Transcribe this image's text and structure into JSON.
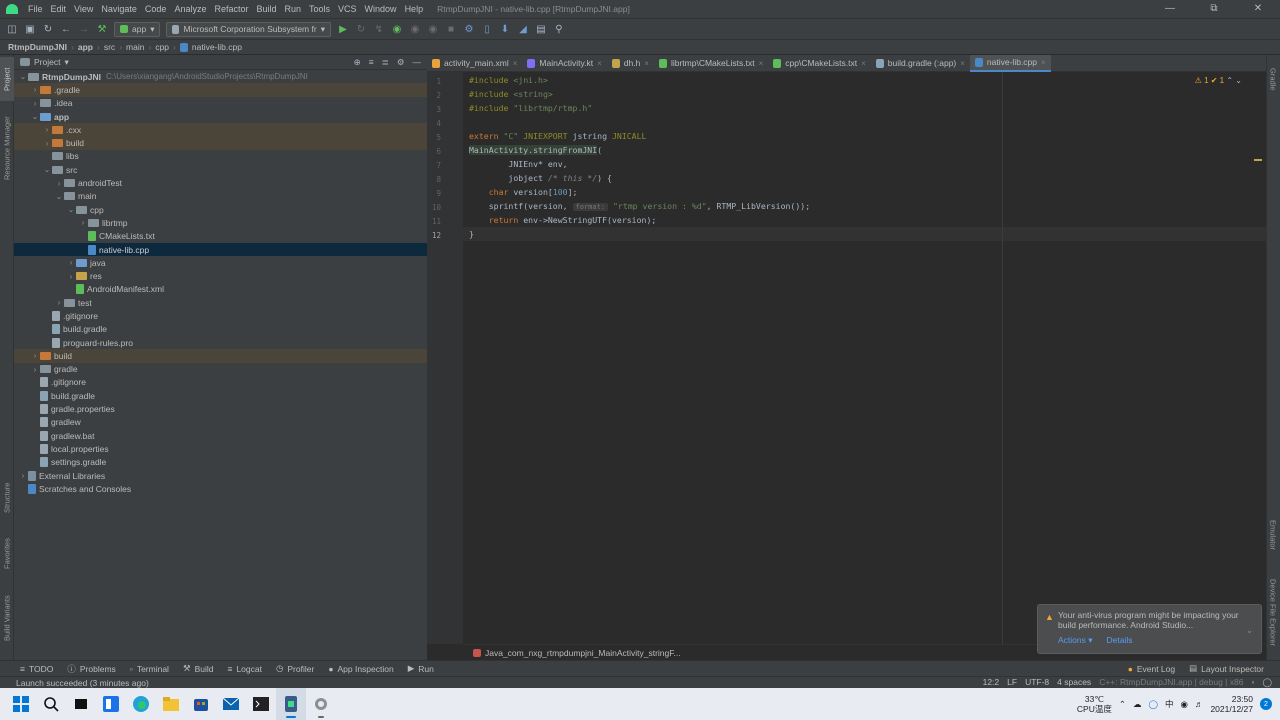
{
  "menu": {
    "items": [
      "File",
      "Edit",
      "View",
      "Navigate",
      "Code",
      "Analyze",
      "Refactor",
      "Build",
      "Run",
      "Tools",
      "VCS",
      "Window",
      "Help"
    ],
    "title": "RtmpDumpJNI - native-lib.cpp [RtmpDumpJNI.app]"
  },
  "toolbar": {
    "config": "app",
    "device": "Microsoft Corporation Subsystem fr"
  },
  "navbar": [
    "RtmpDumpJNI",
    "app",
    "src",
    "main",
    "cpp",
    "native-lib.cpp"
  ],
  "project": {
    "header": "Project",
    "tree": [
      {
        "indent": 0,
        "arrow": "v",
        "icon": "folder",
        "name": "RtmpDumpJNI",
        "hint": "C:\\Users\\xiangang\\AndroidStudioProjects\\RtmpDumpJNI",
        "bold": true
      },
      {
        "indent": 1,
        "arrow": ">",
        "icon": "folder-orange",
        "name": ".gradle",
        "hl": "yellow"
      },
      {
        "indent": 1,
        "arrow": ">",
        "icon": "folder",
        "name": ".idea"
      },
      {
        "indent": 1,
        "arrow": "v",
        "icon": "folder-blue",
        "name": "app",
        "bold": true
      },
      {
        "indent": 2,
        "arrow": ">",
        "icon": "folder-orange",
        "name": ".cxx",
        "hl": "yellow"
      },
      {
        "indent": 2,
        "arrow": ">",
        "icon": "folder-orange",
        "name": "build",
        "hl": "yellow"
      },
      {
        "indent": 2,
        "arrow": "",
        "icon": "folder",
        "name": "libs"
      },
      {
        "indent": 2,
        "arrow": "v",
        "icon": "folder",
        "name": "src"
      },
      {
        "indent": 3,
        "arrow": ">",
        "icon": "folder",
        "name": "androidTest"
      },
      {
        "indent": 3,
        "arrow": "v",
        "icon": "folder",
        "name": "main"
      },
      {
        "indent": 4,
        "arrow": "v",
        "icon": "folder",
        "name": "cpp"
      },
      {
        "indent": 5,
        "arrow": ">",
        "icon": "folder",
        "name": "librtmp"
      },
      {
        "indent": 5,
        "arrow": "",
        "icon": "cmake",
        "name": "CMakeLists.txt"
      },
      {
        "indent": 5,
        "arrow": "",
        "icon": "cpp",
        "name": "native-lib.cpp",
        "hl": "sel"
      },
      {
        "indent": 4,
        "arrow": ">",
        "icon": "folder-blue",
        "name": "java"
      },
      {
        "indent": 4,
        "arrow": ">",
        "icon": "folder-yellow",
        "name": "res"
      },
      {
        "indent": 4,
        "arrow": "",
        "icon": "manifest",
        "name": "AndroidManifest.xml"
      },
      {
        "indent": 3,
        "arrow": ">",
        "icon": "folder",
        "name": "test"
      },
      {
        "indent": 2,
        "arrow": "",
        "icon": "file",
        "name": ".gitignore"
      },
      {
        "indent": 2,
        "arrow": "",
        "icon": "gradle",
        "name": "build.gradle"
      },
      {
        "indent": 2,
        "arrow": "",
        "icon": "file",
        "name": "proguard-rules.pro"
      },
      {
        "indent": 1,
        "arrow": ">",
        "icon": "folder-orange",
        "name": "build",
        "hl": "yellow"
      },
      {
        "indent": 1,
        "arrow": ">",
        "icon": "folder",
        "name": "gradle"
      },
      {
        "indent": 1,
        "arrow": "",
        "icon": "file",
        "name": ".gitignore"
      },
      {
        "indent": 1,
        "arrow": "",
        "icon": "gradle",
        "name": "build.gradle"
      },
      {
        "indent": 1,
        "arrow": "",
        "icon": "file",
        "name": "gradle.properties"
      },
      {
        "indent": 1,
        "arrow": "",
        "icon": "file",
        "name": "gradlew"
      },
      {
        "indent": 1,
        "arrow": "",
        "icon": "file",
        "name": "gradlew.bat"
      },
      {
        "indent": 1,
        "arrow": "",
        "icon": "file",
        "name": "local.properties"
      },
      {
        "indent": 1,
        "arrow": "",
        "icon": "gradle",
        "name": "settings.gradle"
      },
      {
        "indent": 0,
        "arrow": ">",
        "icon": "lib",
        "name": "External Libraries"
      },
      {
        "indent": 0,
        "arrow": "",
        "icon": "scratch",
        "name": "Scratches and Consoles"
      }
    ]
  },
  "left_tabs": [
    "Project",
    "Resource Manager",
    "Structure",
    "Favorites",
    "Build Variants"
  ],
  "right_tabs": [
    "Gradle",
    "Emulator",
    "Device File Explorer"
  ],
  "tabs": [
    {
      "label": "activity_main.xml",
      "color": "#e8a33d"
    },
    {
      "label": "MainActivity.kt",
      "color": "#7f6ff4"
    },
    {
      "label": "dh.h",
      "color": "#c2a24b"
    },
    {
      "label": "librtmp\\CMakeLists.txt",
      "color": "#5ebd5a"
    },
    {
      "label": "cpp\\CMakeLists.txt",
      "color": "#5ebd5a"
    },
    {
      "label": "build.gradle (:app)",
      "color": "#8aa4b4"
    },
    {
      "label": "native-lib.cpp",
      "color": "#4a88c7",
      "active": true
    }
  ],
  "code": {
    "line_numbers": [
      "1",
      "2",
      "3",
      "4",
      "5",
      "6",
      "7",
      "8",
      "9",
      "10",
      "11",
      "12"
    ],
    "lines": [
      [
        [
          "macro",
          "#include "
        ],
        [
          "str",
          "<jni.h>"
        ]
      ],
      [
        [
          "macro",
          "#include "
        ],
        [
          "str",
          "<string>"
        ]
      ],
      [
        [
          "macro",
          "#include "
        ],
        [
          "str",
          "\"librtmp/rtmp.h\""
        ]
      ],
      [],
      [
        [
          "kw",
          "extern "
        ],
        [
          "str",
          "\"C\" "
        ],
        [
          "macro",
          "JNIEXPORT "
        ],
        [
          "",
          "jstring "
        ],
        [
          "macro",
          "JNICALL"
        ]
      ],
      [
        [
          "fn2",
          "MainActivity.stringFromJNI"
        ],
        [
          "",
          "("
        ]
      ],
      [
        [
          "",
          "        JNIEnv* env,"
        ]
      ],
      [
        [
          "",
          "        jobject "
        ],
        [
          "cm",
          "/* this */"
        ],
        [
          "",
          ") {"
        ]
      ],
      [
        [
          "kw",
          "    char "
        ],
        [
          "",
          "version["
        ],
        [
          "num",
          "100"
        ],
        [
          "",
          "];"
        ]
      ],
      [
        [
          "",
          "    sprintf(version, "
        ],
        [
          "hint",
          "format:"
        ],
        [
          "str",
          " \"rtmp version : %d\""
        ],
        [
          "",
          ", RTMP_LibVersion());"
        ]
      ],
      [
        [
          "kw",
          "    return "
        ],
        [
          "",
          "env->NewStringUTF(version);"
        ]
      ],
      [
        [
          "",
          "}"
        ]
      ]
    ],
    "inspection": "⚠ 1  ✔ 1"
  },
  "breadcrumb": "Java_com_nxg_rtmpdumpjni_MainActivity_stringF...",
  "notification": {
    "text": "Your anti-virus program might be impacting your build performance. Android Studio...",
    "actions": "Actions ▾",
    "details": "Details"
  },
  "bottom_tools": [
    "TODO",
    "Problems",
    "Terminal",
    "Build",
    "Logcat",
    "Profiler",
    "App Inspection",
    "Run"
  ],
  "bottom_right": [
    "Event Log",
    "Layout Inspector"
  ],
  "status": {
    "message": "Launch succeeded (3 minutes ago)",
    "position": "12:2",
    "line_sep": "LF",
    "encoding": "UTF-8",
    "indent": "4 spaces",
    "context": "C++: RtmpDumpJNI.app | debug | x86"
  },
  "taskbar": {
    "temp": "33℃",
    "temp_label": "CPU温度",
    "ime": "中",
    "time": "23:50",
    "date": "2021/12/27",
    "badge": "2"
  }
}
